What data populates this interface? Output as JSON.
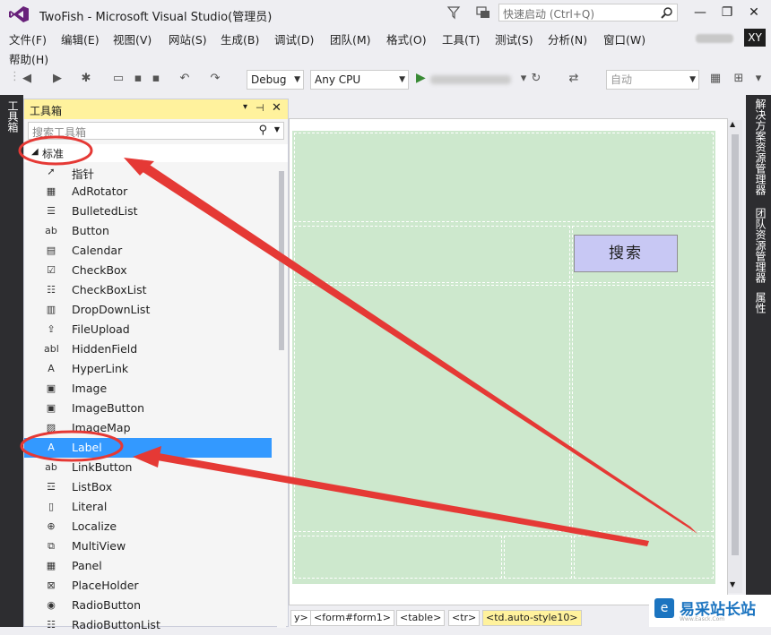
{
  "window": {
    "title": "TwoFish - Microsoft Visual Studio(管理员)",
    "quick_launch_placeholder": "快速启动 (Ctrl+Q)",
    "minimize": "—",
    "restore": "❐",
    "close": "✕",
    "user_initials": "XY"
  },
  "menu": {
    "items": [
      "文件(F)",
      "编辑(E)",
      "视图(V)",
      "网站(S)",
      "生成(B)",
      "调试(D)",
      "团队(M)",
      "格式(O)",
      "工具(T)",
      "测试(S)",
      "分析(N)",
      "窗口(W)"
    ],
    "help": "帮助(H)"
  },
  "toolbar": {
    "config": "Debug",
    "platform": "Any CPU",
    "target_placeholder": "自动"
  },
  "left_strip": {
    "tab": "工具箱"
  },
  "toolbox": {
    "title": "工具箱",
    "pin": "▾",
    "autohide": "⊣",
    "close": "✕",
    "search_placeholder": "搜索工具箱",
    "category": "标准",
    "items": [
      {
        "label": "指针",
        "icon": "pointer-icon",
        "glyph": "➚"
      },
      {
        "label": "AdRotator",
        "icon": "adrotator-icon",
        "glyph": "▦"
      },
      {
        "label": "BulletedList",
        "icon": "bulletedlist-icon",
        "glyph": "☰"
      },
      {
        "label": "Button",
        "icon": "button-icon",
        "glyph": "ab"
      },
      {
        "label": "Calendar",
        "icon": "calendar-icon",
        "glyph": "▤"
      },
      {
        "label": "CheckBox",
        "icon": "checkbox-icon",
        "glyph": "☑"
      },
      {
        "label": "CheckBoxList",
        "icon": "checkboxlist-icon",
        "glyph": "☷"
      },
      {
        "label": "DropDownList",
        "icon": "dropdownlist-icon",
        "glyph": "▥"
      },
      {
        "label": "FileUpload",
        "icon": "fileupload-icon",
        "glyph": "⇪"
      },
      {
        "label": "HiddenField",
        "icon": "hiddenfield-icon",
        "glyph": "abl"
      },
      {
        "label": "HyperLink",
        "icon": "hyperlink-icon",
        "glyph": "A"
      },
      {
        "label": "Image",
        "icon": "image-icon",
        "glyph": "▣"
      },
      {
        "label": "ImageButton",
        "icon": "imagebutton-icon",
        "glyph": "▣"
      },
      {
        "label": "ImageMap",
        "icon": "imagemap-icon",
        "glyph": "▨"
      },
      {
        "label": "Label",
        "icon": "label-icon",
        "glyph": "A"
      },
      {
        "label": "LinkButton",
        "icon": "linkbutton-icon",
        "glyph": "ab"
      },
      {
        "label": "ListBox",
        "icon": "listbox-icon",
        "glyph": "☲"
      },
      {
        "label": "Literal",
        "icon": "literal-icon",
        "glyph": "▯"
      },
      {
        "label": "Localize",
        "icon": "localize-icon",
        "glyph": "⊕"
      },
      {
        "label": "MultiView",
        "icon": "multiview-icon",
        "glyph": "⧉"
      },
      {
        "label": "Panel",
        "icon": "panel-icon",
        "glyph": "▦"
      },
      {
        "label": "PlaceHolder",
        "icon": "placeholder-icon",
        "glyph": "⊠"
      },
      {
        "label": "RadioButton",
        "icon": "radiobutton-icon",
        "glyph": "◉"
      },
      {
        "label": "RadioButtonList",
        "icon": "radiobuttonlist-icon",
        "glyph": "☷"
      }
    ],
    "selected_index": 14
  },
  "design": {
    "search_button": "搜索"
  },
  "right_strip": {
    "tabs": [
      "解决方案资源管理器",
      "团队资源管理器",
      "属性"
    ]
  },
  "breadcrumbs": [
    "y>",
    "<form#form1>",
    "<table>",
    "<tr>",
    "<td.auto-style10>"
  ],
  "watermark": {
    "text": "易采站长站",
    "sub": "Www.Easck.Com"
  },
  "colors": {
    "accent": "#3399ff",
    "annotation": "#e53935",
    "design_bg": "#cde8cd",
    "toolbox_header": "#fff29d",
    "chrome_dark": "#2d2d30"
  }
}
